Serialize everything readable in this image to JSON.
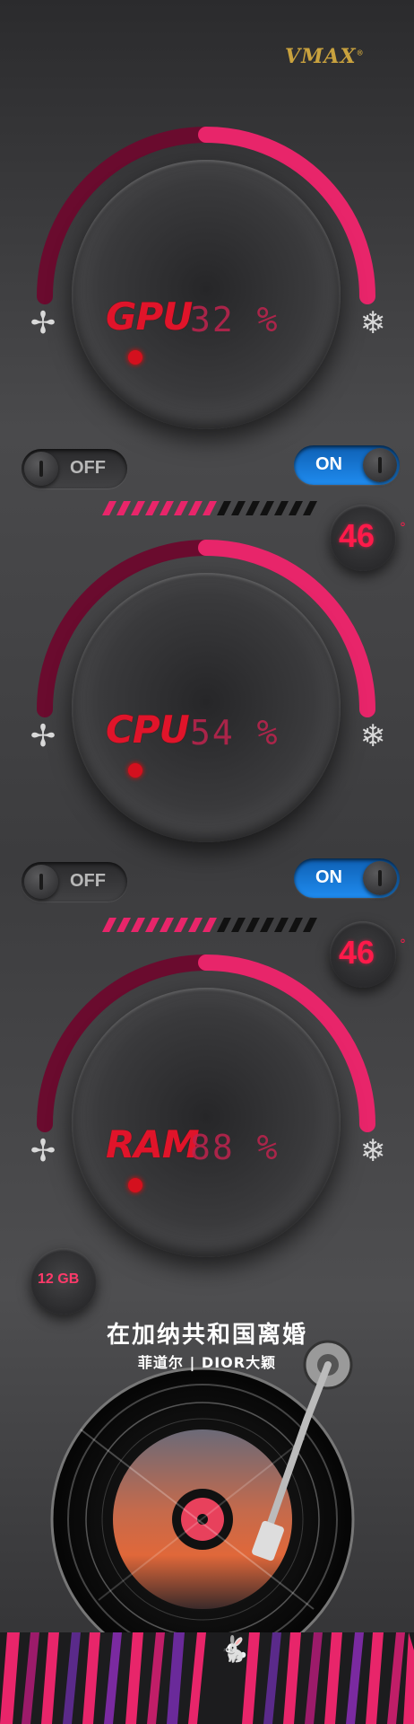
{
  "brand": {
    "name": "VMAX",
    "mark": "®"
  },
  "gauges": [
    {
      "label": "GPU",
      "value": "32 %",
      "fan_icon": "fan-icon",
      "snow_icon": "snowflake-icon"
    },
    {
      "label": "CPU",
      "value": "54 %",
      "fan_icon": "fan-icon",
      "snow_icon": "snowflake-icon"
    },
    {
      "label": "RAM",
      "value": "88 %",
      "fan_icon": "fan-icon",
      "snow_icon": "snowflake-icon"
    }
  ],
  "toggles": [
    {
      "off_label": "OFF",
      "on_label": "ON"
    },
    {
      "off_label": "OFF",
      "on_label": "ON"
    }
  ],
  "temps": [
    {
      "value": "46",
      "unit": "°"
    },
    {
      "value": "46",
      "unit": "°"
    }
  ],
  "memory": {
    "label": "12 GB"
  },
  "music": {
    "title": "在加纳共和国离婚",
    "artist": "菲道尔 | DIOR大颖"
  },
  "colors": {
    "accent": "#e8256a",
    "accent_dark": "#8a0f3a",
    "on_blue": "#1b7fe0",
    "label_red": "#e0142a",
    "brand_gold": "#c9a23e"
  }
}
